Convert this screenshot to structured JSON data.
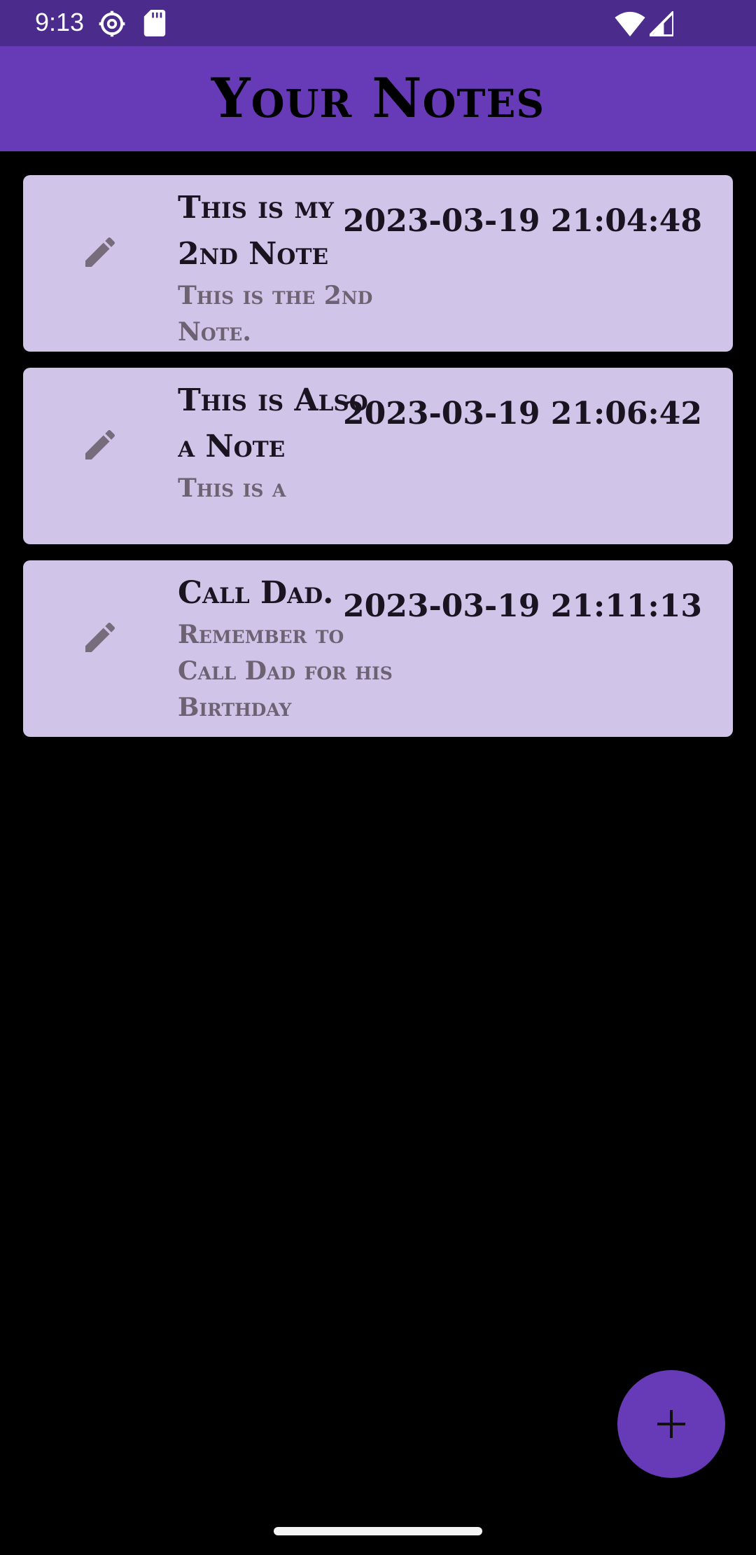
{
  "status_bar": {
    "time": "9:13",
    "icons": [
      "settings-icon",
      "sd-card-icon",
      "wifi-icon",
      "signal-icon"
    ]
  },
  "app_bar": {
    "title": "Your Notes"
  },
  "notes": [
    {
      "title": "This is my 2nd Note",
      "body": "This is the 2nd Note.",
      "timestamp": "2023-03-19 21:04:48",
      "icon": "pencil-icon"
    },
    {
      "title": "This is Also a Note",
      "body": "This is a",
      "timestamp": "2023-03-19 21:06:42",
      "icon": "pencil-icon"
    },
    {
      "title": "Call Dad.",
      "body": "Remember to Call Dad for his Birthday",
      "timestamp": "2023-03-19 21:11:13",
      "icon": "pencil-icon"
    }
  ],
  "fab": {
    "icon": "plus-icon"
  },
  "colors": {
    "status_bar": "#4b2c8c",
    "app_bar": "#673ab7",
    "card": "#d1c4e9",
    "background": "#000000"
  }
}
